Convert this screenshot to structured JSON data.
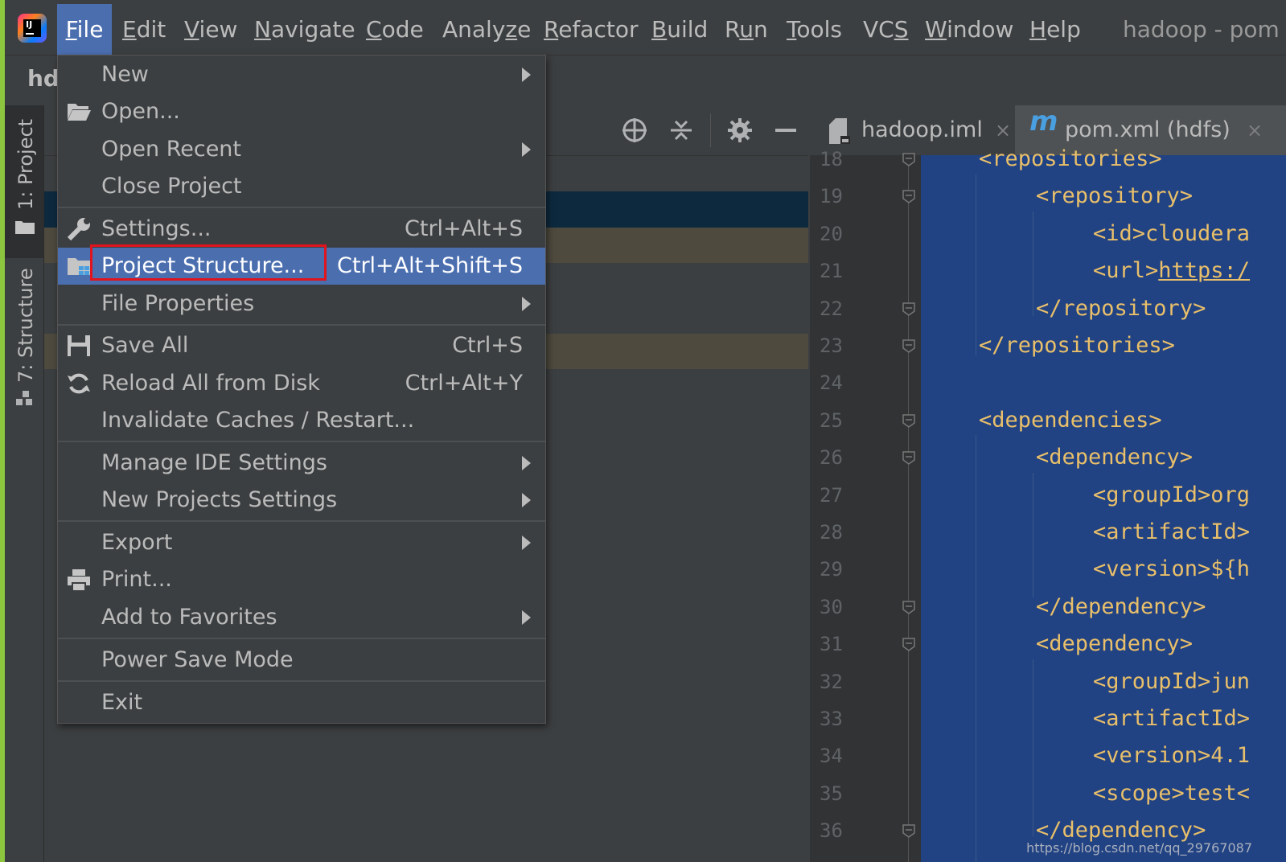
{
  "menubar": {
    "items": [
      {
        "pre": "",
        "u": "F",
        "post": "ile"
      },
      {
        "pre": "",
        "u": "E",
        "post": "dit"
      },
      {
        "pre": "",
        "u": "V",
        "post": "iew"
      },
      {
        "pre": "",
        "u": "N",
        "post": "avigate"
      },
      {
        "pre": "",
        "u": "C",
        "post": "ode"
      },
      {
        "pre": "Analy",
        "u": "z",
        "post": "e"
      },
      {
        "pre": "",
        "u": "R",
        "post": "efactor"
      },
      {
        "pre": "",
        "u": "B",
        "post": "uild"
      },
      {
        "pre": "R",
        "u": "u",
        "post": "n"
      },
      {
        "pre": "",
        "u": "T",
        "post": "ools"
      },
      {
        "pre": "VC",
        "u": "S",
        "post": ""
      },
      {
        "pre": "",
        "u": "W",
        "post": "indow"
      },
      {
        "pre": "",
        "u": "H",
        "post": "elp"
      }
    ],
    "title": "hadoop - pom"
  },
  "breadcrumb": "hd",
  "sidebar": {
    "project_label": "1: Project",
    "structure_label": "7: Structure"
  },
  "file_menu": {
    "new": "New",
    "open": "Open...",
    "open_recent": "Open Recent",
    "close_project": "Close Project",
    "settings": "Settings...",
    "settings_shortcut": "Ctrl+Alt+S",
    "project_structure": "Project Structure...",
    "project_structure_shortcut": "Ctrl+Alt+Shift+S",
    "file_properties": "File Properties",
    "save_all": "Save All",
    "save_all_shortcut": "Ctrl+S",
    "reload": "Reload All from Disk",
    "reload_shortcut": "Ctrl+Alt+Y",
    "invalidate": "Invalidate Caches / Restart...",
    "manage_ide": "Manage IDE Settings",
    "new_projects_settings": "New Projects Settings",
    "export": "Export",
    "print": "Print...",
    "add_favorites": "Add to Favorites",
    "power_save": "Power Save Mode",
    "exit": "Exit"
  },
  "tabs": [
    {
      "label": "hadoop.iml",
      "close": "×"
    },
    {
      "label": "pom.xml (hdfs)",
      "close": "×"
    }
  ],
  "code_lines": [
    {
      "n": "18",
      "text": "<repositories>",
      "indent": 1
    },
    {
      "n": "19",
      "text": "<repository>",
      "indent": 2
    },
    {
      "n": "20",
      "text": "<id>cloudera",
      "indent": 3
    },
    {
      "n": "21",
      "text": "<url>",
      "link": "https:/",
      "indent": 3
    },
    {
      "n": "22",
      "text": "</repository>",
      "indent": 2
    },
    {
      "n": "23",
      "text": "</repositories>",
      "indent": 1
    },
    {
      "n": "24",
      "text": "",
      "indent": 0
    },
    {
      "n": "25",
      "text": "<dependencies>",
      "indent": 1
    },
    {
      "n": "26",
      "text": "<dependency>",
      "indent": 2
    },
    {
      "n": "27",
      "text": "<groupId>org",
      "indent": 3
    },
    {
      "n": "28",
      "text": "<artifactId>",
      "indent": 3
    },
    {
      "n": "29",
      "text": "<version>${h",
      "indent": 3
    },
    {
      "n": "30",
      "text": "</dependency>",
      "indent": 2
    },
    {
      "n": "31",
      "text": "<dependency>",
      "indent": 2
    },
    {
      "n": "32",
      "text": "<groupId>jun",
      "indent": 3
    },
    {
      "n": "33",
      "text": "<artifactId>",
      "indent": 3
    },
    {
      "n": "34",
      "text": "<version>4.1",
      "indent": 3
    },
    {
      "n": "35",
      "text": "<scope>test<",
      "indent": 3
    },
    {
      "n": "36",
      "text": "</dependency>",
      "indent": 2
    }
  ],
  "watermark": "https://blog.csdn.net/qq_29767087",
  "colors": {
    "accent": "#4b6eaf",
    "highlight_box": "#e0141e",
    "xml_tag": "#e8bf6a",
    "selection": "#214283"
  }
}
